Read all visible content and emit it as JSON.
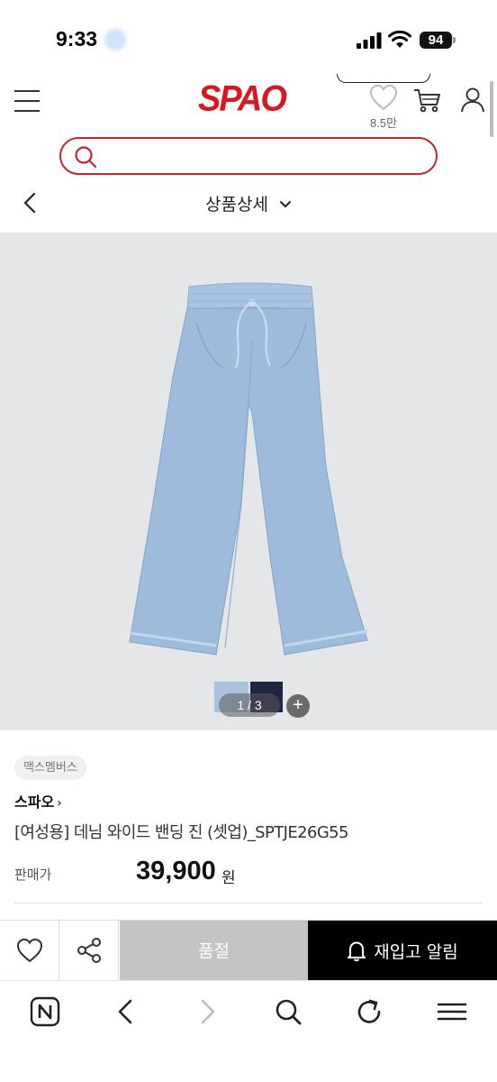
{
  "status_bar": {
    "time": "9:33",
    "battery": "94"
  },
  "header": {
    "logo": "SPAO",
    "wish_count": "8.5만"
  },
  "search": {
    "placeholder": "",
    "value": ""
  },
  "subheader": {
    "title": "상품상세"
  },
  "gallery": {
    "pager": "1 / 3",
    "plus": "+"
  },
  "product": {
    "badge": "맥스멤버스",
    "brand": "스파오",
    "brand_arrow": "›",
    "name": "[여성용] 데님 와이드 밴딩 진 (셋업)_SPTJE26G55",
    "price_label": "판매가",
    "price": "39,900",
    "price_unit": "원"
  },
  "actions": {
    "soldout_label": "품절",
    "restock_label": "재입고 알림"
  },
  "colors": {
    "brand_red": "#d7191f",
    "search_border": "#c4262e",
    "soldout_bg": "#c4c4c4",
    "restock_bg": "#000000",
    "denim": "#9ebbdc"
  }
}
